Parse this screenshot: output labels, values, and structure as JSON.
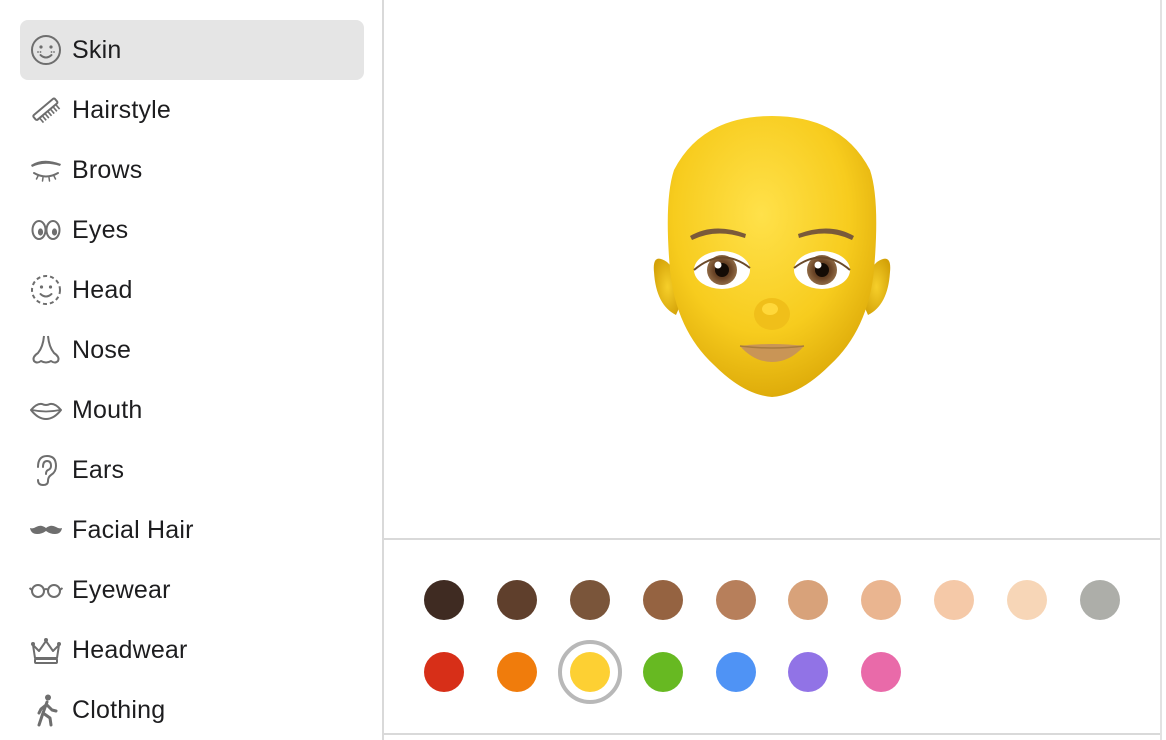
{
  "sidebar": {
    "items": [
      {
        "label": "Skin",
        "icon": "smile-freckles-icon"
      },
      {
        "label": "Hairstyle",
        "icon": "comb-icon"
      },
      {
        "label": "Brows",
        "icon": "brow-icon"
      },
      {
        "label": "Eyes",
        "icon": "eyes-icon"
      },
      {
        "label": "Head",
        "icon": "head-outline-icon"
      },
      {
        "label": "Nose",
        "icon": "nose-icon"
      },
      {
        "label": "Mouth",
        "icon": "lips-icon"
      },
      {
        "label": "Ears",
        "icon": "ear-icon"
      },
      {
        "label": "Facial Hair",
        "icon": "mustache-icon"
      },
      {
        "label": "Eyewear",
        "icon": "glasses-icon"
      },
      {
        "label": "Headwear",
        "icon": "crown-icon"
      },
      {
        "label": "Clothing",
        "icon": "walking-figure-icon"
      }
    ],
    "selected": "Skin"
  },
  "skin_colors": {
    "row1": [
      "#3f2b22",
      "#5f3f2c",
      "#7a553a",
      "#956341",
      "#b77f5b",
      "#d8a27a",
      "#eab590",
      "#f5c9a8",
      "#f7d6b7",
      "#adaea9"
    ],
    "row2": [
      "#d72f18",
      "#f07c0c",
      "#fdd033",
      "#67b922",
      "#4f93f5",
      "#9173e6",
      "#e96aa9"
    ],
    "selected": "#fdd033"
  },
  "colors": {
    "selected_bg": "#e5e5e5",
    "text": "#1d1d1f",
    "icon": "#6e6e6e"
  }
}
